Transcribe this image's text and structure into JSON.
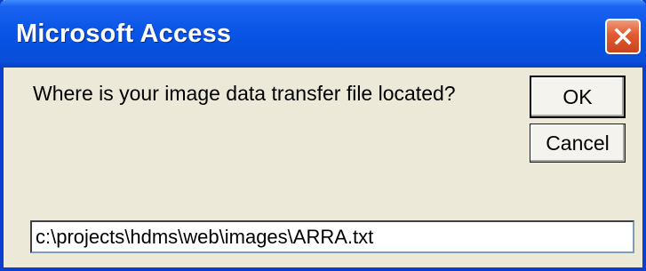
{
  "window": {
    "title": "Microsoft Access",
    "close_icon": "close-icon"
  },
  "dialog": {
    "prompt": "Where is your image data transfer file located?",
    "ok_label": "OK",
    "cancel_label": "Cancel",
    "input_value": "c:\\projects\\hdms\\web\\images\\ARRA.txt"
  },
  "colors": {
    "titlebar": "#0a55e6",
    "frame": "#0a3fd0",
    "dialog_bg": "#ece9d8",
    "close_button": "#e25a30"
  }
}
